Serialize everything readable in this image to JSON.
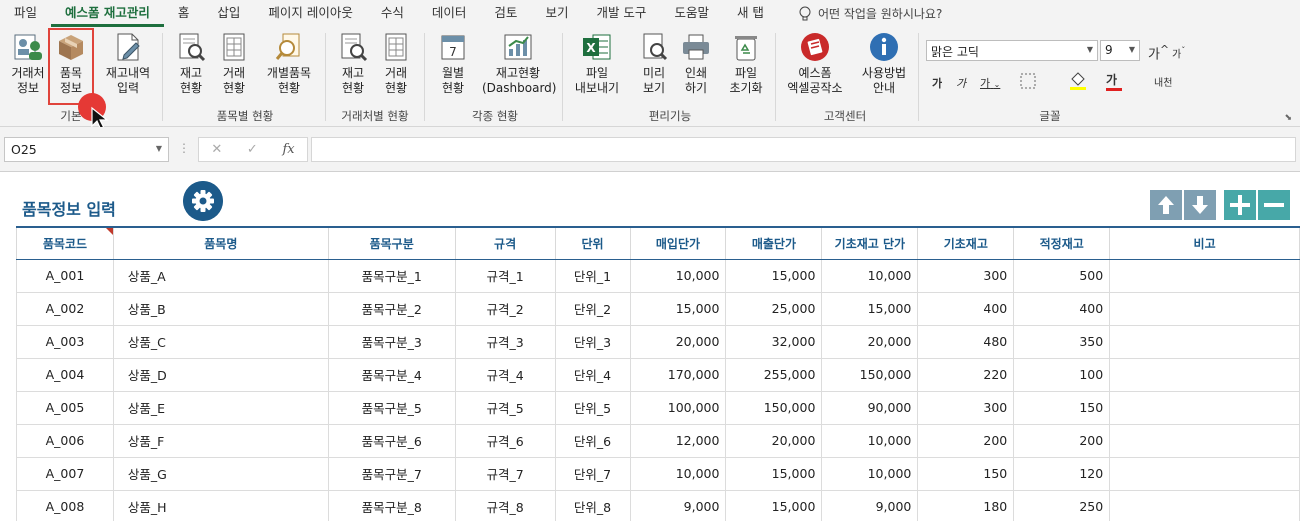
{
  "tabs": [
    "파일",
    "예스폼 재고관리",
    "홈",
    "삽입",
    "페이지 레이아웃",
    "수식",
    "데이터",
    "검토",
    "보기",
    "개발 도구",
    "도움말",
    "새 탭"
  ],
  "active_tab": "예스폼 재고관리",
  "help_search": "어떤 작업을 원하시나요?",
  "ribbon": {
    "buttons": {
      "client_info": "거래처\n정보",
      "item_info": "품목\n정보",
      "stock_entry": "재고내역\n입력",
      "item_stock": "재고\n현황",
      "item_trade": "거래\n현황",
      "item_each": "개별품목\n현황",
      "client_stock": "재고\n현황",
      "client_trade": "거래\n현황",
      "monthly": "월별\n현황",
      "dashboard": "재고현황\n(Dashboard)",
      "export": "파일\n내보내기",
      "preview": "미리\n보기",
      "print": "인쇄\n하기",
      "reset": "파일\n초기화",
      "yesform": "예스폼\n엑셀공작소",
      "guide": "사용방법\n안내"
    },
    "groups": {
      "basic": "기본",
      "by_item": "품목별 현황",
      "by_client": "거래처별 현황",
      "various": "각종 현황",
      "convenience": "편리기능",
      "support": "고객센터",
      "font": "글꼴"
    },
    "font_name": "맑은 고딕",
    "font_size": "9",
    "grow_font": "가",
    "shrink_font": "가",
    "bold": "가",
    "italic": "가",
    "underline": "가",
    "font_color_glyph": "가",
    "phonetic": "내천"
  },
  "formula_bar": {
    "name_box": "O25",
    "cancel": "✕",
    "enter": "✓",
    "fx": "fx",
    "value": ""
  },
  "sheet": {
    "title": "품목정보 입력",
    "columns": [
      "품목코드",
      "품목명",
      "품목구분",
      "규격",
      "단위",
      "매입단가",
      "매출단가",
      "기초재고 단가",
      "기초재고",
      "적정재고",
      "비고"
    ],
    "rows": [
      [
        "A_001",
        "상품_A",
        "품목구분_1",
        "규격_1",
        "단위_1",
        "10,000",
        "15,000",
        "10,000",
        "300",
        "500",
        ""
      ],
      [
        "A_002",
        "상품_B",
        "품목구분_2",
        "규격_2",
        "단위_2",
        "15,000",
        "25,000",
        "15,000",
        "400",
        "400",
        ""
      ],
      [
        "A_003",
        "상품_C",
        "품목구분_3",
        "규격_3",
        "단위_3",
        "20,000",
        "32,000",
        "20,000",
        "480",
        "350",
        ""
      ],
      [
        "A_004",
        "상품_D",
        "품목구분_4",
        "규격_4",
        "단위_4",
        "170,000",
        "255,000",
        "150,000",
        "220",
        "100",
        ""
      ],
      [
        "A_005",
        "상품_E",
        "품목구분_5",
        "규격_5",
        "단위_5",
        "100,000",
        "150,000",
        "90,000",
        "300",
        "150",
        ""
      ],
      [
        "A_006",
        "상품_F",
        "품목구분_6",
        "규격_6",
        "단위_6",
        "12,000",
        "20,000",
        "10,000",
        "200",
        "200",
        ""
      ],
      [
        "A_007",
        "상품_G",
        "품목구분_7",
        "규격_7",
        "단위_7",
        "10,000",
        "15,000",
        "10,000",
        "150",
        "120",
        ""
      ],
      [
        "A_008",
        "상품_H",
        "품목구분_8",
        "규격_8",
        "단위_8",
        "9,000",
        "15,000",
        "9,000",
        "180",
        "250",
        ""
      ]
    ]
  },
  "colors": {
    "brand_green": "#1e6f3e",
    "header_blue": "#1c5a8a",
    "nav_gray": "#7f9fb2",
    "nav_teal": "#47a8a8",
    "highlight_red": "#e0443b"
  }
}
